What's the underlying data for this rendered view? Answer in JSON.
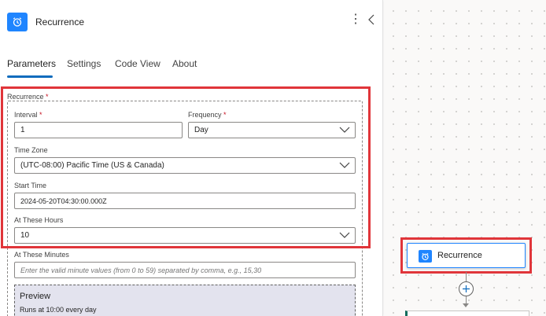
{
  "header": {
    "title": "Recurrence",
    "icon": "alarm-clock-icon",
    "more_icon": "more-vertical-icon",
    "collapse_icon": "chevron-left-icon"
  },
  "tabs": [
    {
      "label": "Parameters",
      "active": true
    },
    {
      "label": "Settings",
      "active": false
    },
    {
      "label": "Code View",
      "active": false
    },
    {
      "label": "About",
      "active": false
    }
  ],
  "form": {
    "recurrence_label": "Recurrence",
    "required_mark": "*",
    "interval": {
      "label": "Interval",
      "value": "1"
    },
    "frequency": {
      "label": "Frequency",
      "value": "Day"
    },
    "time_zone": {
      "label": "Time Zone",
      "value": "(UTC-08:00) Pacific Time (US & Canada)"
    },
    "start_time": {
      "label": "Start Time",
      "value": "2024-05-20T04:30:00.000Z"
    },
    "at_these_hours": {
      "label": "At These Hours",
      "value": "10"
    },
    "at_these_minutes": {
      "label": "At These Minutes",
      "placeholder": "Enter the valid minute values (from 0 to 59) separated by comma, e.g., 15,30"
    }
  },
  "preview": {
    "title": "Preview",
    "text": "Runs at 10:00 every day"
  },
  "canvas": {
    "node_label": "Recurrence",
    "node_icon": "alarm-clock-icon",
    "add_icon": "plus-icon"
  },
  "colors": {
    "accent": "#1f85ff",
    "tab_underline": "#0f6cbd",
    "highlight": "#e0353a",
    "required": "#c50f1f"
  }
}
